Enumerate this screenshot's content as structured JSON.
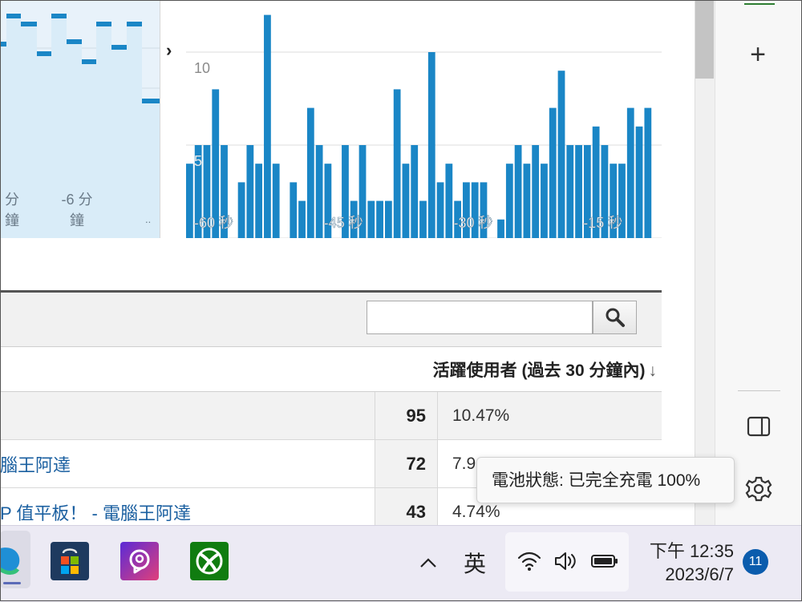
{
  "colors": {
    "bar": "#1a86c6",
    "area_fill": "#d9ecf8",
    "area_line": "#1a86c6",
    "link": "#1a5fa0",
    "badge": "#0b5cad"
  },
  "minute_chart": {
    "tick_labels": [
      {
        "line1": "分",
        "line2": "鐘"
      },
      {
        "line1": "-6 分",
        "line2": "鐘"
      }
    ],
    "more_label": ".."
  },
  "nav": {
    "next_icon": "chevron-right-icon"
  },
  "chart_data": {
    "type": "bar",
    "x": [
      -60,
      -59,
      -58,
      -57,
      -56,
      -55,
      -54,
      -53,
      -52,
      -51,
      -50,
      -49,
      -48,
      -47,
      -46,
      -45,
      -44,
      -43,
      -42,
      -41,
      -40,
      -39,
      -38,
      -37,
      -36,
      -35,
      -34,
      -33,
      -32,
      -31,
      -30,
      -29,
      -28,
      -27,
      -26,
      -25,
      -24,
      -23,
      -22,
      -21,
      -20,
      -19,
      -18,
      -17,
      -16,
      -15,
      -14,
      -13,
      -12,
      -11,
      -10,
      -9,
      -8,
      -7,
      -6
    ],
    "values": [
      4,
      5,
      5,
      8,
      5,
      0,
      3,
      5,
      4,
      12,
      4,
      0,
      3,
      2,
      7,
      5,
      4,
      0,
      5,
      2,
      5,
      2,
      2,
      2,
      8,
      4,
      5,
      2,
      10,
      3,
      4,
      2,
      3,
      3,
      3,
      0,
      1,
      4,
      5,
      4,
      5,
      4,
      7,
      9,
      5,
      5,
      5,
      6,
      5,
      4,
      4,
      7,
      6,
      7,
      0
    ],
    "x_tick_labels": [
      "-60 秒",
      "-45 秒",
      "-30 秒",
      "-15 秒"
    ],
    "y_tick_labels": [
      "5",
      "10"
    ],
    "ylim": [
      0,
      12.7
    ],
    "grid": true
  },
  "search": {
    "placeholder": "",
    "value": ""
  },
  "table": {
    "column_header": "活躍使用者 (過去 30 分鐘內)",
    "rows": [
      {
        "title": "",
        "count": "95",
        "percent": "10.47%"
      },
      {
        "title": "腦王阿達",
        "count": "72",
        "percent": "7.9..."
      },
      {
        "title": "P 值平板！ - 電腦王阿達",
        "count": "43",
        "percent": "4.74%"
      }
    ]
  },
  "tooltip": {
    "text": "電池狀態: 已完全充電 100%"
  },
  "sidebar": {
    "add_icon": "plus-icon",
    "split_icon": "split-screen-icon",
    "settings_icon": "gear-icon"
  },
  "taskbar": {
    "apps": [
      "edge-icon",
      "microsoft-store-icon",
      "copilot-icon",
      "xbox-icon"
    ],
    "ime": "英",
    "clock_time": "下午 12:35",
    "clock_date": "2023/6/7",
    "notification_count": "11"
  }
}
